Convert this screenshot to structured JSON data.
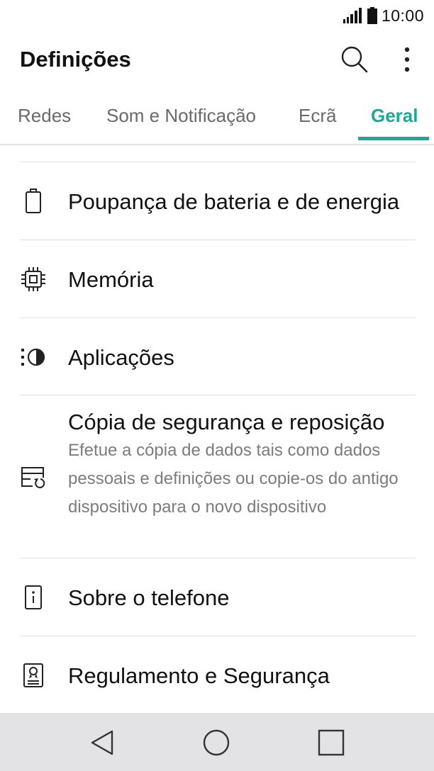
{
  "status_bar": {
    "time": "10:00",
    "signal_icon": "signal-icon",
    "battery_icon": "battery-icon"
  },
  "app_bar": {
    "title": "Definições",
    "search_icon": "search-icon",
    "more_icon": "more-vert-icon"
  },
  "tabs": [
    {
      "label": "Redes",
      "active": false
    },
    {
      "label": "Som e Notificação",
      "active": false
    },
    {
      "label": "Ecrã",
      "active": false
    },
    {
      "label": "Geral",
      "active": true
    }
  ],
  "accent_color": "#18a99a",
  "items": [
    {
      "icon": "battery-outline-icon",
      "title": "Poupança de bateria e de energia"
    },
    {
      "icon": "memory-chip-icon",
      "title": "Memória"
    },
    {
      "icon": "apps-icon",
      "title": "Aplicações"
    },
    {
      "icon": "backup-restore-icon",
      "title": "Cópia de segurança e reposição",
      "subtitle": "Efetue a cópia de dados tais como dados pessoais e definições ou copie-os do antigo dispositivo para o novo dispositivo"
    },
    {
      "icon": "info-icon",
      "title": "Sobre o telefone"
    },
    {
      "icon": "certificate-icon",
      "title": "Regulamento e Segurança"
    }
  ],
  "nav_bar": {
    "back_icon": "back-icon",
    "home_icon": "home-icon",
    "recents_icon": "recents-icon"
  }
}
